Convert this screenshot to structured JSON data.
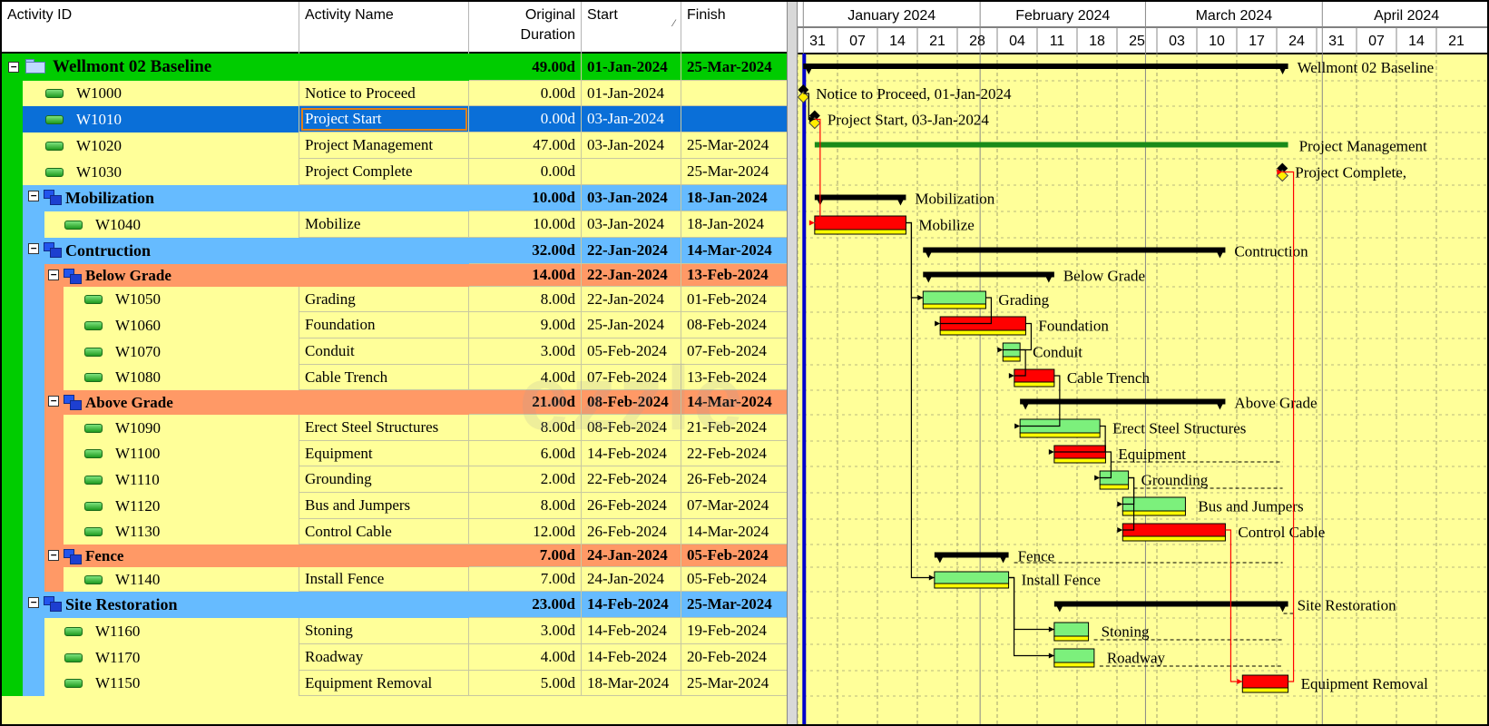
{
  "columns": {
    "activity_id": "Activity ID",
    "activity_name": "Activity Name",
    "duration_line1": "Original",
    "duration_line2": "Duration",
    "start": "Start",
    "finish": "Finish"
  },
  "timescale": {
    "months": [
      "January 2024",
      "February 2024",
      "March 2024",
      "April 2024"
    ],
    "weeks": [
      "31",
      "07",
      "14",
      "21",
      "28",
      "04",
      "11",
      "18",
      "25",
      "03",
      "10",
      "17",
      "24",
      "31",
      "07",
      "14",
      "21"
    ]
  },
  "watermark": "ezzle",
  "colors": {
    "project_band": "#00cc00",
    "wbs_band": "#66bbff",
    "subwbs_band": "#ff9966",
    "row_bg": "#ffff99",
    "selected_row": "#0a6fd8",
    "critical_bar": "#ff0000",
    "normal_bar": "#7cf07c",
    "baseline_bar": "#ffff00",
    "data_date_line": "#0000cc"
  },
  "rows": [
    {
      "id": "Wellmont 02 Baseline",
      "name": "",
      "dur": "49.00d",
      "start": "01-Jan-2024",
      "finish": "25-Mar-2024",
      "type": "project",
      "level": 0,
      "start_date": "2024-01-01",
      "finish_date": "2024-03-25",
      "label": "Wellmont 02 Baseline"
    },
    {
      "id": "W1000",
      "name": "Notice to Proceed",
      "dur": "0.00d",
      "start": "01-Jan-2024",
      "finish": "",
      "type": "milestone",
      "level": 1,
      "start_date": "2024-01-01",
      "finish_date": "2024-01-01",
      "label": "Notice to Proceed, 01-Jan-2024"
    },
    {
      "id": "W1010",
      "name": "Project Start",
      "dur": "0.00d",
      "start": "03-Jan-2024",
      "finish": "",
      "type": "milestone",
      "level": 1,
      "selected": true,
      "start_date": "2024-01-03",
      "finish_date": "2024-01-03",
      "label": "Project Start, 03-Jan-2024"
    },
    {
      "id": "W1020",
      "name": "Project Management",
      "dur": "47.00d",
      "start": "03-Jan-2024",
      "finish": "25-Mar-2024",
      "type": "loe",
      "level": 1,
      "start_date": "2024-01-03",
      "finish_date": "2024-03-25",
      "label": "Project Management"
    },
    {
      "id": "W1030",
      "name": "Project Complete",
      "dur": "0.00d",
      "start": "",
      "finish": "25-Mar-2024",
      "type": "milestone",
      "level": 1,
      "start_date": "2024-03-25",
      "finish_date": "2024-03-25",
      "label": "Project Complete,"
    },
    {
      "id": "Mobilization",
      "name": "",
      "dur": "10.00d",
      "start": "03-Jan-2024",
      "finish": "18-Jan-2024",
      "type": "wbs",
      "level": 1,
      "start_date": "2024-01-03",
      "finish_date": "2024-01-18",
      "label": "Mobilization"
    },
    {
      "id": "W1040",
      "name": "Mobilize",
      "dur": "10.00d",
      "start": "03-Jan-2024",
      "finish": "18-Jan-2024",
      "type": "task",
      "critical": true,
      "level": 2,
      "start_date": "2024-01-03",
      "finish_date": "2024-01-18",
      "label": "Mobilize"
    },
    {
      "id": "Contruction",
      "name": "",
      "dur": "32.00d",
      "start": "22-Jan-2024",
      "finish": "14-Mar-2024",
      "type": "wbs",
      "level": 1,
      "start_date": "2024-01-22",
      "finish_date": "2024-03-14",
      "label": "Contruction"
    },
    {
      "id": "Below Grade",
      "name": "",
      "dur": "14.00d",
      "start": "22-Jan-2024",
      "finish": "13-Feb-2024",
      "type": "subwbs",
      "level": 2,
      "start_date": "2024-01-22",
      "finish_date": "2024-02-13",
      "label": "Below Grade"
    },
    {
      "id": "W1050",
      "name": "Grading",
      "dur": "8.00d",
      "start": "22-Jan-2024",
      "finish": "01-Feb-2024",
      "type": "task",
      "critical": false,
      "level": 3,
      "start_date": "2024-01-22",
      "finish_date": "2024-02-01",
      "label": "Grading"
    },
    {
      "id": "W1060",
      "name": "Foundation",
      "dur": "9.00d",
      "start": "25-Jan-2024",
      "finish": "08-Feb-2024",
      "type": "task",
      "critical": true,
      "level": 3,
      "start_date": "2024-01-25",
      "finish_date": "2024-02-08",
      "label": "Foundation"
    },
    {
      "id": "W1070",
      "name": "Conduit",
      "dur": "3.00d",
      "start": "05-Feb-2024",
      "finish": "07-Feb-2024",
      "type": "task",
      "critical": false,
      "level": 3,
      "start_date": "2024-02-05",
      "finish_date": "2024-02-07",
      "label": "Conduit"
    },
    {
      "id": "W1080",
      "name": "Cable Trench",
      "dur": "4.00d",
      "start": "07-Feb-2024",
      "finish": "13-Feb-2024",
      "type": "task",
      "critical": true,
      "level": 3,
      "start_date": "2024-02-07",
      "finish_date": "2024-02-13",
      "label": "Cable Trench"
    },
    {
      "id": "Above Grade",
      "name": "",
      "dur": "21.00d",
      "start": "08-Feb-2024",
      "finish": "14-Mar-2024",
      "type": "subwbs",
      "level": 2,
      "start_date": "2024-02-08",
      "finish_date": "2024-03-14",
      "label": "Above Grade"
    },
    {
      "id": "W1090",
      "name": "Erect Steel Structures",
      "dur": "8.00d",
      "start": "08-Feb-2024",
      "finish": "21-Feb-2024",
      "type": "task",
      "critical": false,
      "level": 3,
      "start_date": "2024-02-08",
      "finish_date": "2024-02-21",
      "label": "Erect Steel Structures"
    },
    {
      "id": "W1100",
      "name": "Equipment",
      "dur": "6.00d",
      "start": "14-Feb-2024",
      "finish": "22-Feb-2024",
      "type": "task",
      "critical": true,
      "level": 3,
      "start_date": "2024-02-14",
      "finish_date": "2024-02-22",
      "label": "Equipment"
    },
    {
      "id": "W1110",
      "name": "Grounding",
      "dur": "2.00d",
      "start": "22-Feb-2024",
      "finish": "26-Feb-2024",
      "type": "task",
      "critical": false,
      "level": 3,
      "start_date": "2024-02-22",
      "finish_date": "2024-02-26",
      "label": "Grounding"
    },
    {
      "id": "W1120",
      "name": "Bus and Jumpers",
      "dur": "8.00d",
      "start": "26-Feb-2024",
      "finish": "07-Mar-2024",
      "type": "task",
      "critical": false,
      "level": 3,
      "start_date": "2024-02-26",
      "finish_date": "2024-03-07",
      "label": "Bus and Jumpers"
    },
    {
      "id": "W1130",
      "name": "Control Cable",
      "dur": "12.00d",
      "start": "26-Feb-2024",
      "finish": "14-Mar-2024",
      "type": "task",
      "critical": true,
      "level": 3,
      "start_date": "2024-02-26",
      "finish_date": "2024-03-14",
      "label": "Control Cable"
    },
    {
      "id": "Fence",
      "name": "",
      "dur": "7.00d",
      "start": "24-Jan-2024",
      "finish": "05-Feb-2024",
      "type": "subwbs",
      "level": 2,
      "start_date": "2024-01-24",
      "finish_date": "2024-02-05",
      "label": "Fence"
    },
    {
      "id": "W1140",
      "name": "Install Fence",
      "dur": "7.00d",
      "start": "24-Jan-2024",
      "finish": "05-Feb-2024",
      "type": "task",
      "critical": false,
      "level": 3,
      "start_date": "2024-01-24",
      "finish_date": "2024-02-05",
      "label": "Install Fence"
    },
    {
      "id": "Site Restoration",
      "name": "",
      "dur": "23.00d",
      "start": "14-Feb-2024",
      "finish": "25-Mar-2024",
      "type": "wbs",
      "level": 1,
      "start_date": "2024-02-14",
      "finish_date": "2024-03-25",
      "label": "Site Restoration"
    },
    {
      "id": "W1160",
      "name": "Stoning",
      "dur": "3.00d",
      "start": "14-Feb-2024",
      "finish": "19-Feb-2024",
      "type": "task",
      "critical": false,
      "level": 2,
      "start_date": "2024-02-14",
      "finish_date": "2024-02-19",
      "label": "Stoning"
    },
    {
      "id": "W1170",
      "name": "Roadway",
      "dur": "4.00d",
      "start": "14-Feb-2024",
      "finish": "20-Feb-2024",
      "type": "task",
      "critical": false,
      "level": 2,
      "start_date": "2024-02-14",
      "finish_date": "2024-02-20",
      "label": "Roadway"
    },
    {
      "id": "W1150",
      "name": "Equipment Removal",
      "dur": "5.00d",
      "start": "18-Mar-2024",
      "finish": "25-Mar-2024",
      "type": "task",
      "critical": true,
      "level": 2,
      "start_date": "2024-03-18",
      "finish_date": "2024-03-25",
      "label": "Equipment Removal"
    }
  ],
  "links": [
    [
      "W1000",
      "W1010"
    ],
    [
      "W1010",
      "W1040"
    ],
    [
      "W1040",
      "W1050"
    ],
    [
      "W1040",
      "W1140"
    ],
    [
      "W1050",
      "W1060"
    ],
    [
      "W1060",
      "W1070"
    ],
    [
      "W1070",
      "W1080"
    ],
    [
      "W1080",
      "W1090"
    ],
    [
      "W1090",
      "W1100"
    ],
    [
      "W1100",
      "W1110"
    ],
    [
      "W1110",
      "W1120"
    ],
    [
      "W1110",
      "W1130"
    ],
    [
      "W1130",
      "W1150"
    ],
    [
      "W1140",
      "W1160"
    ],
    [
      "W1140",
      "W1170"
    ],
    [
      "W1150",
      "W1030"
    ]
  ]
}
